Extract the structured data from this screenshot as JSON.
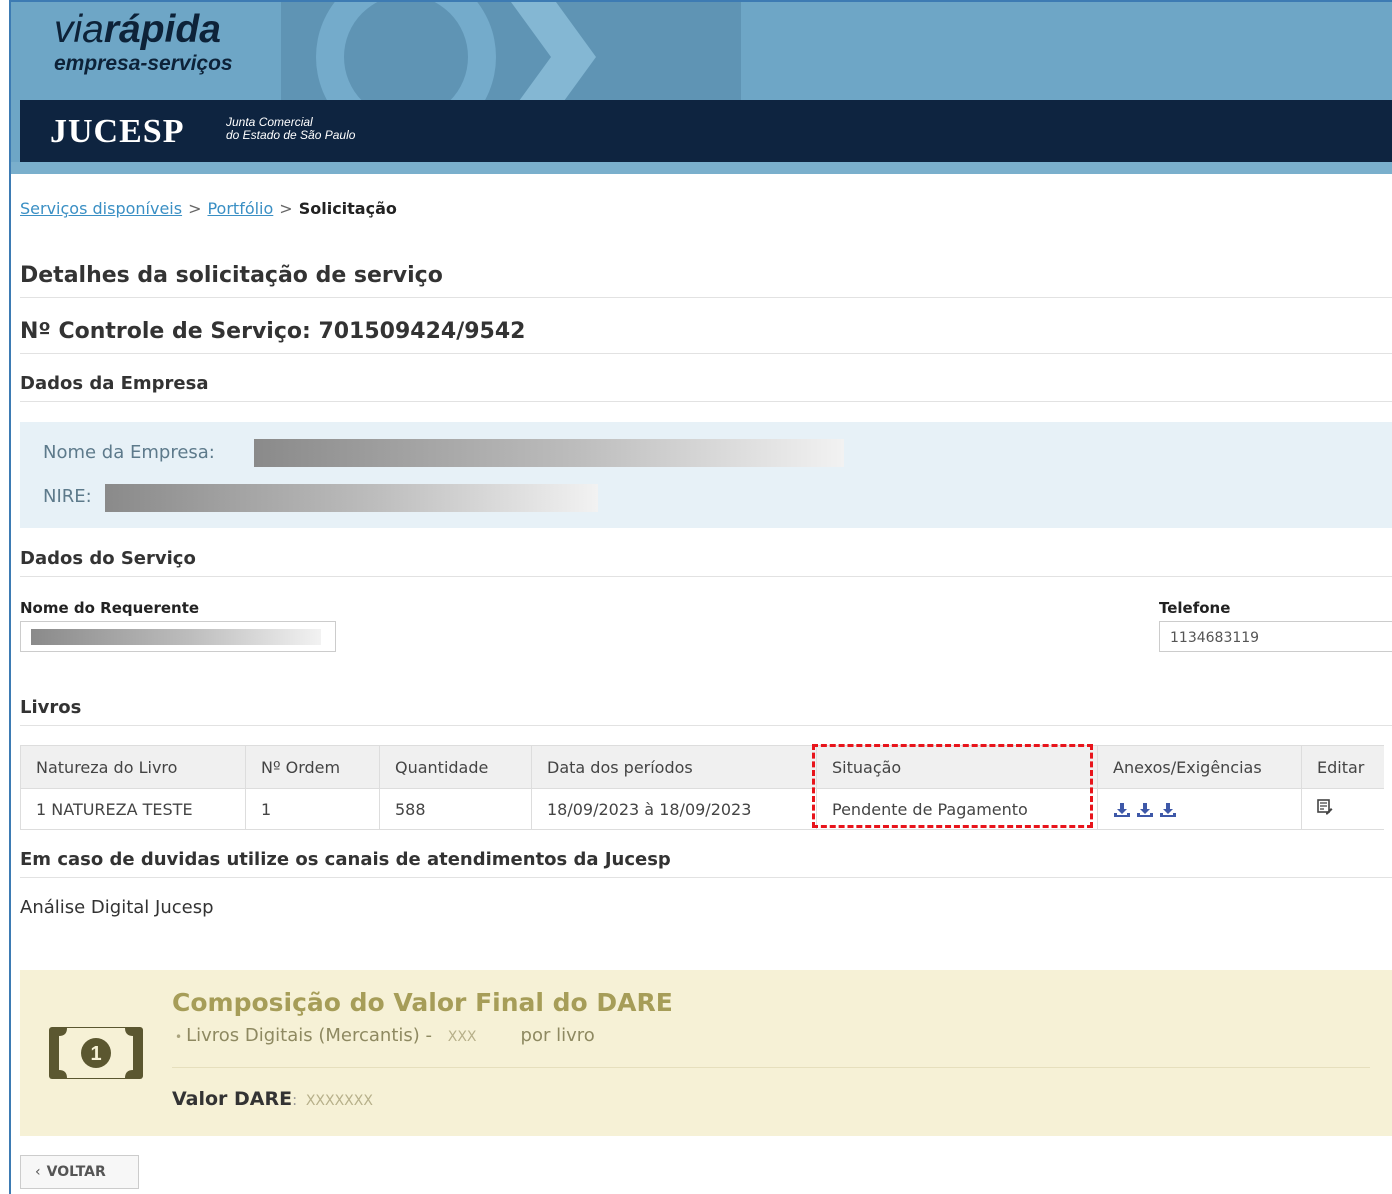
{
  "header": {
    "brand_via": "via",
    "brand_rapida": "rápida",
    "brand_sub": "empresa-serviços",
    "jucesp_logo": "JUCESP",
    "jucesp_line1": "Junta Comercial",
    "jucesp_line2": "do Estado de São Paulo"
  },
  "breadcrumb": {
    "item1": "Serviços disponíveis",
    "item2": "Portfólio",
    "current": "Solicitação",
    "separator": ">"
  },
  "page": {
    "title": "Detalhes da solicitação de serviço",
    "control_number": "Nº Controle de Serviço: 701509424/9542"
  },
  "empresa": {
    "section_title": "Dados da Empresa",
    "nome_label": "Nome da Empresa:",
    "nire_label": "NIRE:"
  },
  "servico": {
    "section_title": "Dados do Serviço",
    "requerente_label": "Nome do Requerente",
    "telefone_label": "Telefone",
    "telefone_value": "1134683119"
  },
  "livros": {
    "section_title": "Livros",
    "columns": [
      "Natureza do Livro",
      "Nº Ordem",
      "Quantidade",
      "Data dos períodos",
      "Situação",
      "Anexos/Exigências",
      "Editar"
    ],
    "rows": [
      {
        "natureza": "1 NATUREZA TESTE",
        "ordem": "1",
        "quantidade": "588",
        "periodos": "18/09/2023 à 18/09/2023",
        "situacao": "Pendente de Pagamento"
      }
    ]
  },
  "duvidas": {
    "title": "Em caso de duvidas utilize os canais de atendimentos da Jucesp",
    "text": "Análise Digital Jucesp"
  },
  "dare": {
    "title": "Composição do Valor Final do DARE",
    "bullet": "•",
    "item_label": "Livros Digitais (Mercantis) -",
    "item_value": "XXX",
    "item_suffix": "por livro",
    "valor_label": "Valor DARE",
    "valor_colon": ":",
    "valor_value": "XXXXXXX"
  },
  "actions": {
    "voltar": "VOLTAR",
    "voltar_icon": "‹"
  },
  "colors": {
    "header_blue": "#6ea6c6",
    "jucesp_bar": "#0e2440",
    "link": "#3a8fc4",
    "highlight": "#e8141b",
    "panel": "#e7f1f7",
    "dare_bg": "#f6f1d6"
  }
}
